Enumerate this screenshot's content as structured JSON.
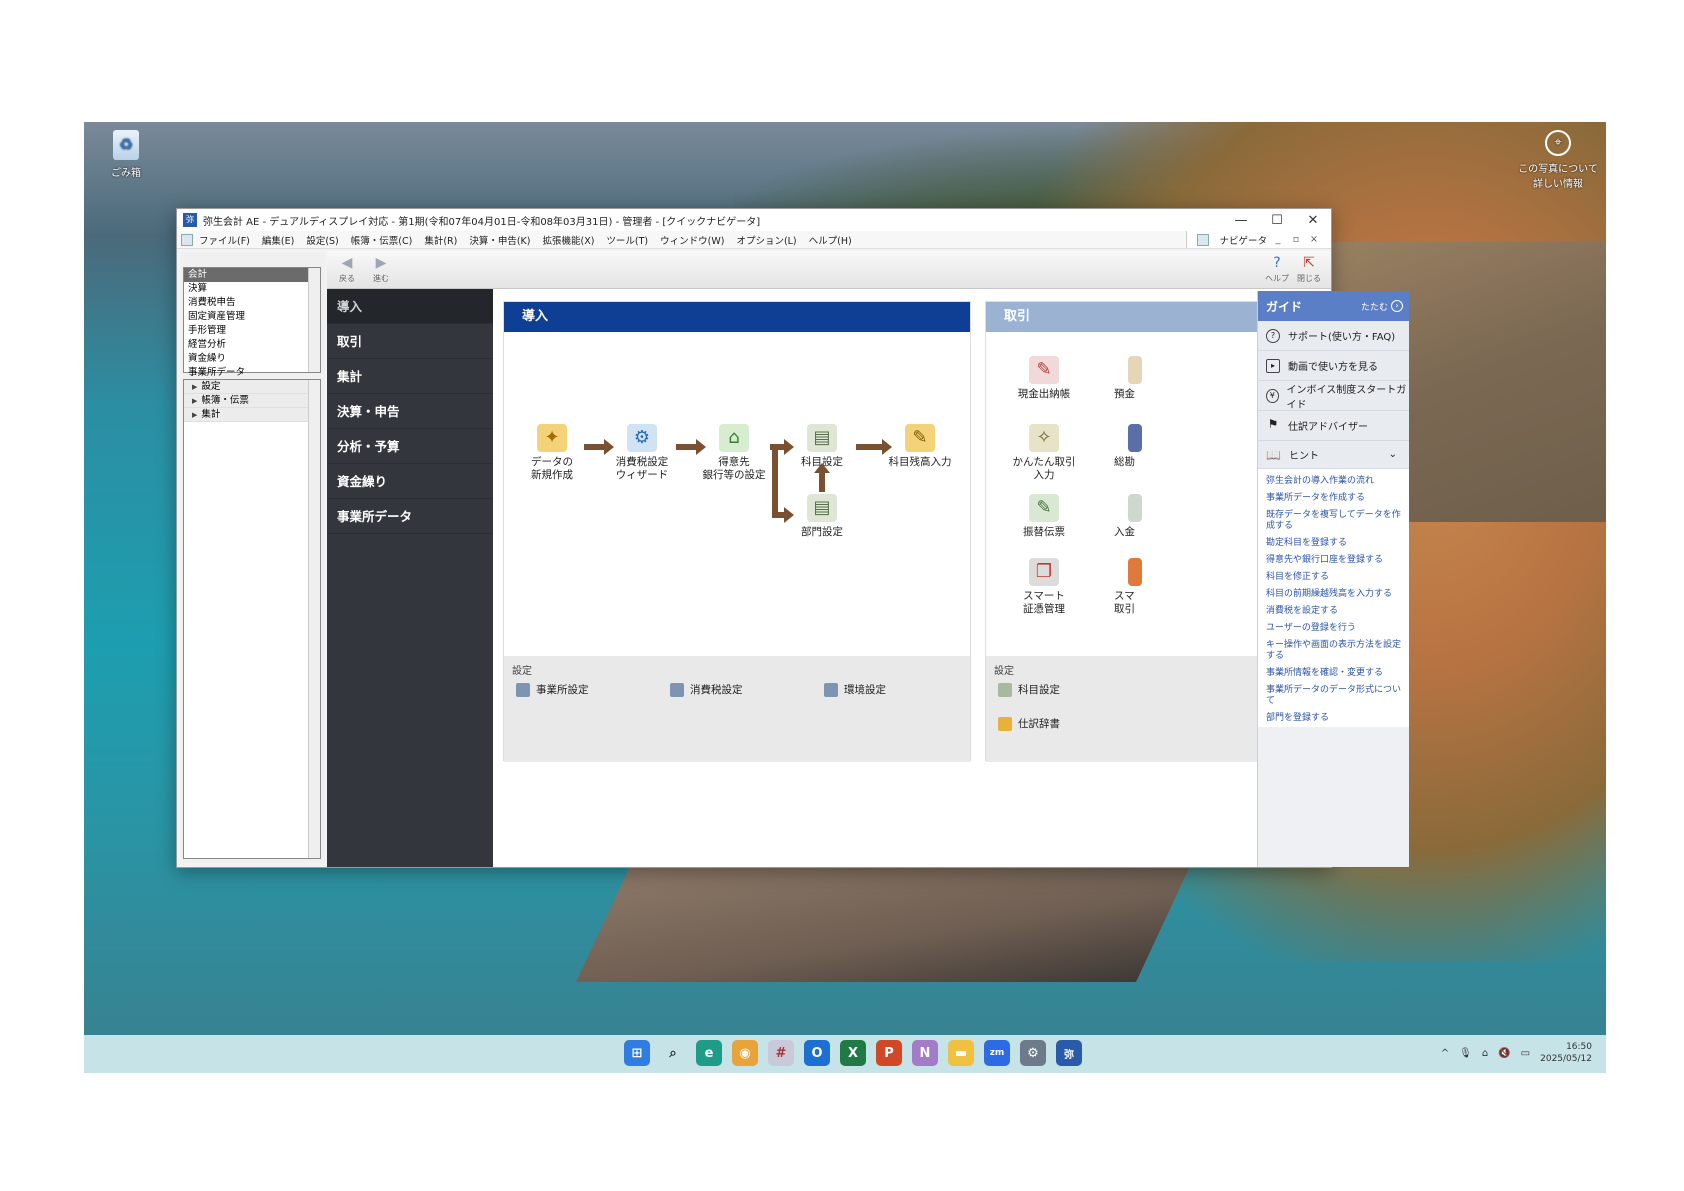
{
  "desktop": {
    "recycle_label": "ごみ箱",
    "info_label": "この写真について 詳しい情報"
  },
  "window": {
    "title": "弥生会計 AE - デュアルディスプレイ対応 - 第1期(令和07年04月01日-令和08年03月31日) - 管理者 - [クイックナビゲータ]",
    "minimize": "—",
    "maximize": "☐",
    "close": "✕"
  },
  "menu": {
    "items": [
      "ファイル(F)",
      "編集(E)",
      "設定(S)",
      "帳簿・伝票(C)",
      "集計(R)",
      "決算・申告(K)",
      "拡張機能(X)",
      "ツール(T)",
      "ウィンドウ(W)",
      "オプション(L)",
      "ヘルプ(H)"
    ],
    "navi_tab": "ナビゲータ"
  },
  "left_list": {
    "items": [
      "会計",
      "決算",
      "消費税申告",
      "固定資産管理",
      "手形管理",
      "経営分析",
      "資金繰り",
      "事業所データ"
    ],
    "selected_index": 0
  },
  "left_tree": {
    "items": [
      "設定",
      "帳簿・伝票",
      "集計"
    ]
  },
  "toolbar": {
    "back": "戻る",
    "forward": "進む",
    "help": "ヘルプ",
    "close": "閉じる"
  },
  "categories": [
    "導入",
    "取引",
    "集計",
    "決算・申告",
    "分析・予算",
    "資金繰り",
    "事業所データ"
  ],
  "active_category": "導入",
  "intro_panel": {
    "title": "導入",
    "flow": {
      "new_data": "データの\n新規作成",
      "tax_wizard": "消費税設定\nウィザード",
      "bank_setup": "得意先\n銀行等の設定",
      "account_setup": "科目設定",
      "dept_setup": "部門設定",
      "opening_balance": "科目残高入力"
    },
    "settings_label": "設定",
    "settings": [
      "事業所設定",
      "消費税設定",
      "環境設定"
    ]
  },
  "trade_panel": {
    "title": "取引",
    "items": {
      "cash_book": "現金出納帳",
      "easy_entry": "かんたん取引\n入力",
      "transfer_slip": "振替伝票",
      "smart_voucher": "スマート\n証憑管理",
      "deposit_partial": "預金",
      "general_partial": "総勘",
      "receipt_partial": "入金",
      "smart_partial": "スマ\n取引"
    },
    "settings_label": "設定",
    "settings": [
      "科目設定",
      "仕訳辞書"
    ]
  },
  "guide": {
    "title": "ガイド",
    "close_label": "たたむ",
    "items": [
      {
        "icon": "question-icon",
        "label": "サポート(使い方・FAQ)"
      },
      {
        "icon": "video-icon",
        "label": "動画で使い方を見る"
      },
      {
        "icon": "invoice-icon",
        "label": "インボイス制度スタートガイド"
      },
      {
        "icon": "flag-icon",
        "label": "仕訳アドバイザー"
      }
    ],
    "hint_label": "ヒント",
    "hints": [
      "弥生会計の導入作業の流れ",
      "事業所データを作成する",
      "既存データを複写してデータを作成する",
      "勘定科目を登録する",
      "得意先や銀行口座を登録する",
      "科目を修正する",
      "科目の前期繰越残高を入力する",
      "消費税を設定する",
      "ユーザーの登録を行う",
      "キー操作や画面の表示方法を設定する",
      "事業所情報を確認・変更する",
      "事業所データのデータ形式について",
      "部門を登録する"
    ]
  },
  "taskbar": {
    "time": "16:50",
    "date": "2025/05/12"
  },
  "colors": {
    "intro_header": "#0e3f95",
    "trade_header": "#9bb2d3",
    "guide_header": "#5b7fc7",
    "category_bg": "#33373d",
    "flow_arrow": "#7a5030",
    "hint_link": "#2b54a8"
  }
}
